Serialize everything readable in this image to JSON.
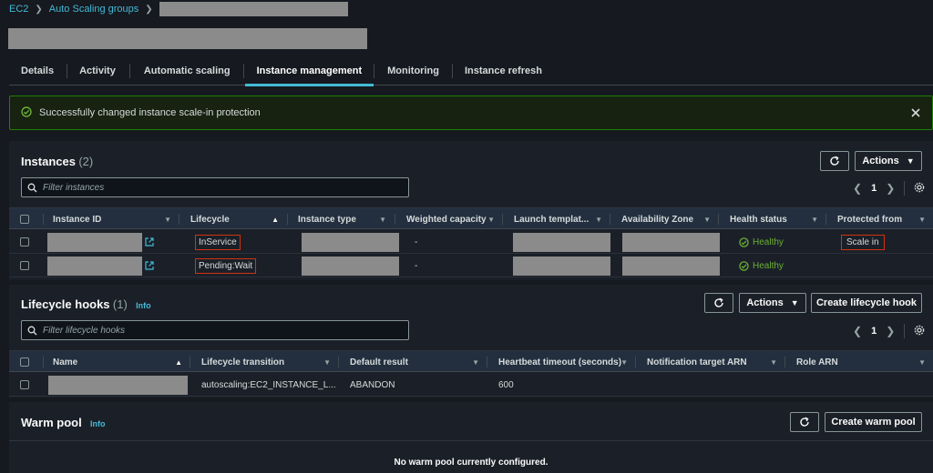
{
  "breadcrumb": {
    "root": "EC2",
    "section": "Auto Scaling groups"
  },
  "tabs": [
    "Details",
    "Activity",
    "Automatic scaling",
    "Instance management",
    "Monitoring",
    "Instance refresh"
  ],
  "flash": {
    "message": "Successfully changed instance scale-in protection"
  },
  "instances": {
    "title": "Instances",
    "count": "(2)",
    "actions_label": "Actions",
    "filter_placeholder": "Filter instances",
    "page": "1",
    "columns": [
      "Instance ID",
      "Lifecycle",
      "Instance type",
      "Weighted capacity",
      "Launch templat...",
      "Availability Zone",
      "Health status",
      "Protected from"
    ],
    "rows": [
      {
        "lifecycle": "InService",
        "weighted_capacity": "-",
        "health": "Healthy",
        "protected_from": "Scale in"
      },
      {
        "lifecycle": "Pending:Wait",
        "weighted_capacity": "-",
        "health": "Healthy",
        "protected_from": ""
      }
    ]
  },
  "lifecycle_hooks": {
    "title": "Lifecycle hooks",
    "count": "(1)",
    "info": "Info",
    "actions_label": "Actions",
    "create_label": "Create lifecycle hook",
    "filter_placeholder": "Filter lifecycle hooks",
    "page": "1",
    "columns": [
      "Name",
      "Lifecycle transition",
      "Default result",
      "Heartbeat timeout (seconds)",
      "Notification target ARN",
      "Role ARN"
    ],
    "rows": [
      {
        "transition": "autoscaling:EC2_INSTANCE_L...",
        "default_result": "ABANDON",
        "heartbeat": "600"
      }
    ]
  },
  "warm_pool": {
    "title": "Warm pool",
    "info": "Info",
    "create_label": "Create warm pool",
    "empty_message": "No warm pool currently configured."
  },
  "colors": {
    "accent": "#44b9d6",
    "success": "#1d8102",
    "healthy": "#6aaf35",
    "highlight": "#d13212"
  }
}
